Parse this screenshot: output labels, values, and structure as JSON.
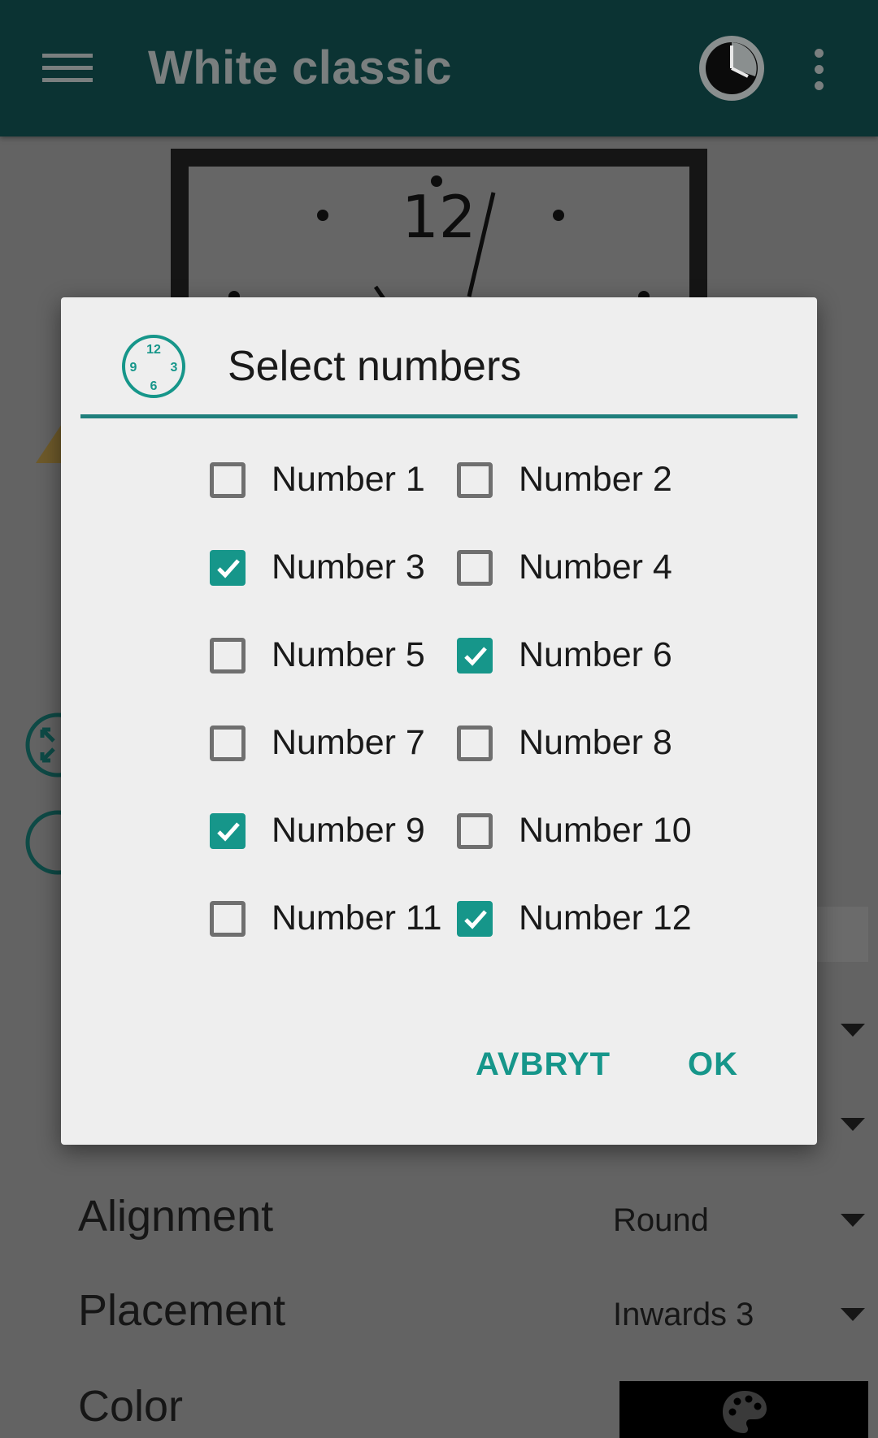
{
  "app_bar": {
    "title": "White classic",
    "menu_icon": "hamburger-menu-icon",
    "clock_icon": "clock-icon",
    "overflow_icon": "more-vert-icon"
  },
  "preview": {
    "number_label": "12"
  },
  "background_settings": [
    {
      "label": "Alignment",
      "value": "Round"
    },
    {
      "label": "Placement",
      "value": "Inwards 3"
    },
    {
      "label": "Color",
      "value": ""
    }
  ],
  "dialog": {
    "title": "Select numbers",
    "icon_numbers": [
      "12",
      "3",
      "6",
      "9"
    ],
    "options": [
      {
        "label": "Number 1",
        "checked": false
      },
      {
        "label": "Number 2",
        "checked": false
      },
      {
        "label": "Number 3",
        "checked": true
      },
      {
        "label": "Number 4",
        "checked": false
      },
      {
        "label": "Number 5",
        "checked": false
      },
      {
        "label": "Number 6",
        "checked": true
      },
      {
        "label": "Number 7",
        "checked": false
      },
      {
        "label": "Number 8",
        "checked": false
      },
      {
        "label": "Number 9",
        "checked": true
      },
      {
        "label": "Number 10",
        "checked": false
      },
      {
        "label": "Number 11",
        "checked": false
      },
      {
        "label": "Number 12",
        "checked": true
      }
    ],
    "cancel_label": "AVBRYT",
    "ok_label": "OK"
  },
  "colors": {
    "app_bar": "#0b3333",
    "accent": "#16968a",
    "dialog_background": "#eeeeee",
    "scrim": "#636363"
  }
}
